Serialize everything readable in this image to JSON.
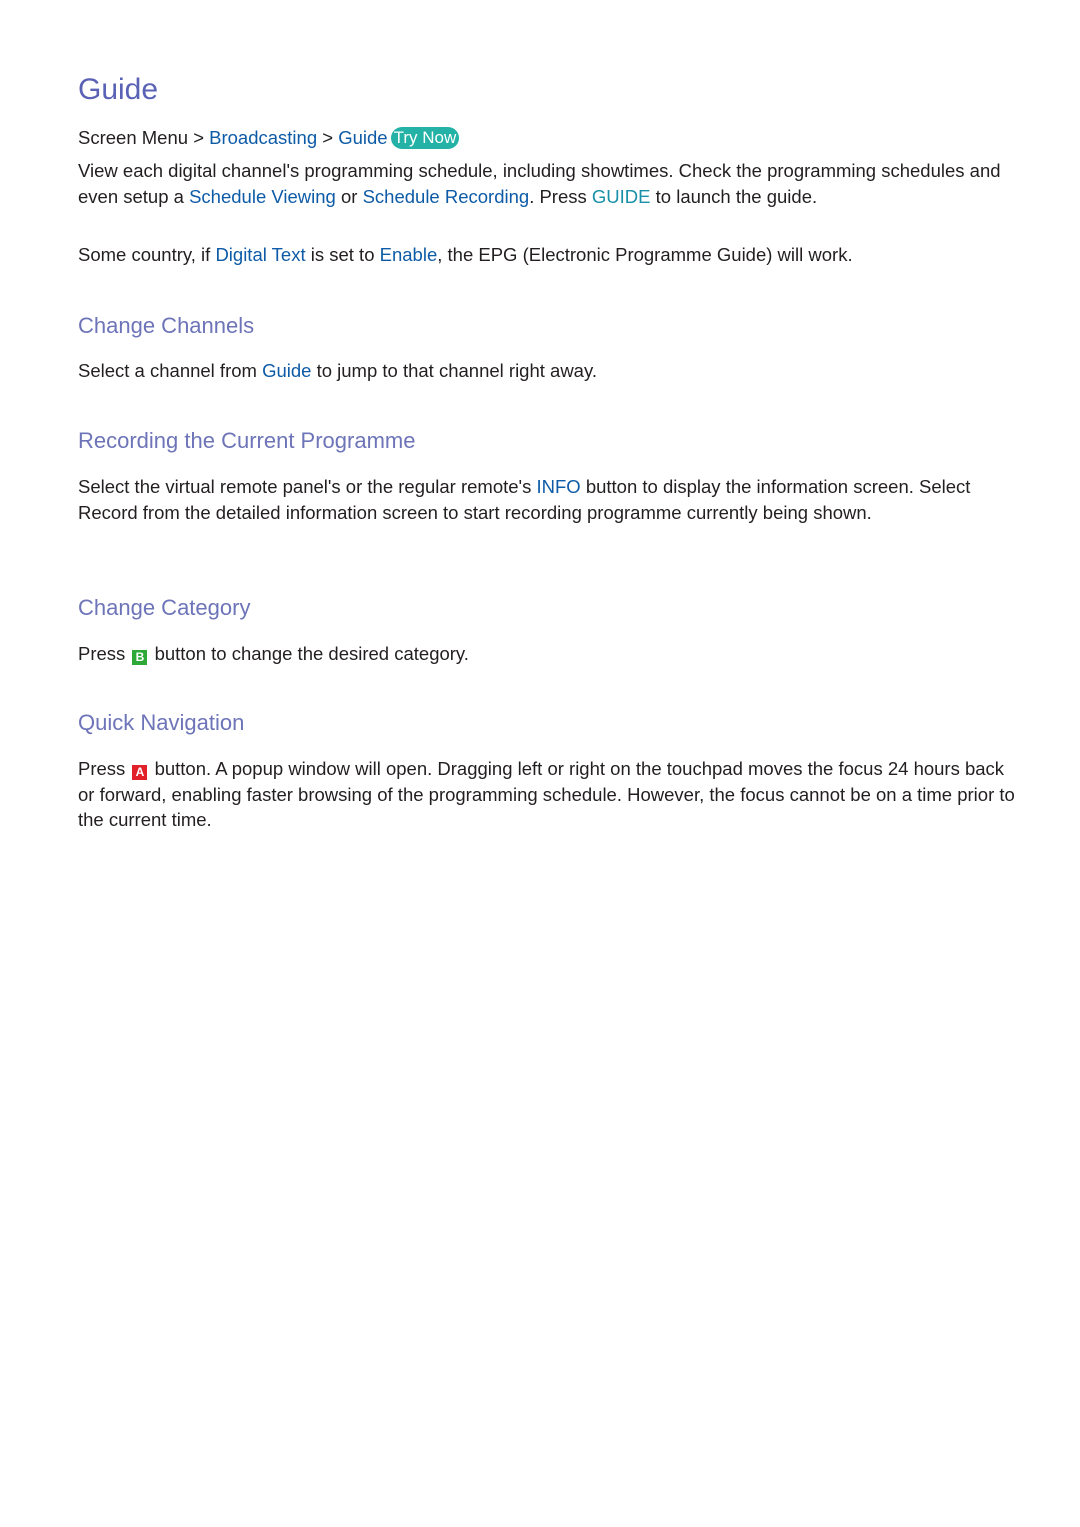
{
  "page": {
    "title": "Guide",
    "breadcrumb": {
      "root": "Screen Menu",
      "separator": ">",
      "items": [
        "Broadcasting",
        "Guide"
      ],
      "try_now": "Try Now"
    },
    "intro": {
      "p1": {
        "t1": "View each digital channel's programming schedule, including showtimes. Check the programming schedules and even setup a ",
        "link1": "Schedule Viewing",
        "t2": " or ",
        "link2": "Schedule Recording",
        "t3": ". Press ",
        "key": "GUIDE",
        "t4": " to launch the guide."
      },
      "p2": {
        "t1": "Some country, if ",
        "link1": "Digital Text",
        "t2": " is set to ",
        "link2": "Enable",
        "t3": ", the EPG (Electronic Programme Guide) will work."
      }
    },
    "sections": [
      {
        "title": "Change Channels",
        "body": {
          "t1": "Select a channel from ",
          "link1": "Guide",
          "t2": " to jump to that channel right away."
        }
      },
      {
        "title": "Recording the Current Programme",
        "body": {
          "t1": "Select the virtual remote panel's or the regular remote's ",
          "key": "INFO",
          "t2": " button to display the information screen. Select Record from the detailed information screen to start recording programme currently being shown."
        }
      },
      {
        "title": "Change Category",
        "body": {
          "t1": "Press ",
          "button_icon": "B",
          "t2": " button to change the desired category."
        }
      },
      {
        "title": "Quick Navigation",
        "body": {
          "t1": "Press ",
          "button_icon": "A",
          "t2": " button. A popup window will open. Dragging left or right on the touchpad moves the focus 24 hours back or forward, enabling faster browsing of the programming schedule. However, the focus cannot be on a time prior to the current time."
        }
      }
    ],
    "colors": {
      "title": "#5a62b5",
      "section_title": "#6d74b8",
      "link": "#0d5ba7",
      "key_teal": "#1790a8",
      "try_now_bg": "#23b2a5",
      "b_button": "#2ea836",
      "a_button": "#e2202a"
    }
  }
}
